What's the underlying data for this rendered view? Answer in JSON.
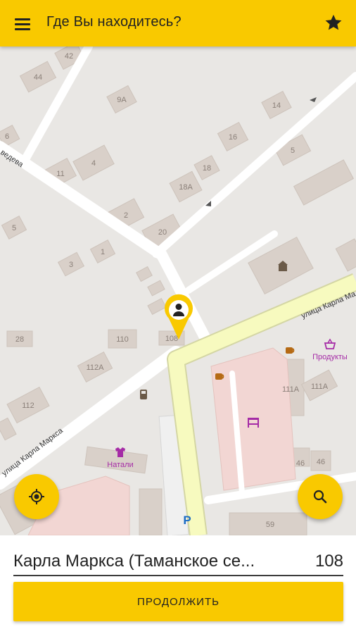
{
  "appbar": {
    "title": "Где Вы находитесь?",
    "menu_icon": "menu-icon",
    "favorite_icon": "star-icon"
  },
  "map": {
    "streets": [
      "улица Карла Маркса",
      "улица Карла Ма",
      "ведева"
    ],
    "house_numbers": [
      "42",
      "44",
      "9A",
      "14",
      "6",
      "16",
      "5",
      "11",
      "4",
      "18",
      "18A",
      "2",
      "20",
      "5",
      "1",
      "3",
      "28",
      "110",
      "108",
      "112A",
      "112",
      "111A",
      "111A",
      "46",
      "46",
      "59"
    ],
    "pois": [
      "Продукты",
      "Натали"
    ],
    "parking_label": "P"
  },
  "fab": {
    "locate_icon": "my-location-icon",
    "search_icon": "search-icon"
  },
  "address": {
    "street": "Карла Маркса (Таманское се...",
    "house": "108"
  },
  "continue_label": "ПРОДОЛЖИТЬ",
  "colors": {
    "accent": "#f9c900",
    "map_bg": "#e9e7e4",
    "road_major": "#f7fabf",
    "building": "#d9d0c9",
    "pink_area": "#f2d6d3"
  }
}
